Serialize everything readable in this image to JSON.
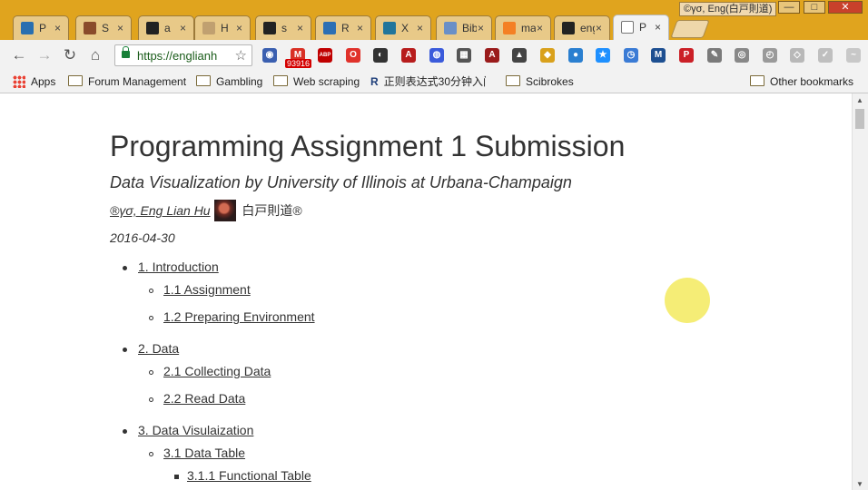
{
  "window": {
    "profile": "©γσ, Eng(白戸則道)",
    "minimize": "—",
    "maximize": "□",
    "close": "✕"
  },
  "tabs": [
    {
      "title": "P",
      "icon": "infinity-icon",
      "color": "#2a6fb0"
    },
    {
      "title": "S",
      "icon": "photo-icon",
      "color": "#8a4b2b"
    },
    {
      "title": "a",
      "icon": "github-icon",
      "color": "#222222"
    },
    {
      "title": "H",
      "icon": "chart-icon",
      "color": "#c0a070"
    },
    {
      "title": "s",
      "icon": "github-icon",
      "color": "#222222"
    },
    {
      "title": "R",
      "icon": "r-icon",
      "color": "#2c6fb4"
    },
    {
      "title": "X",
      "icon": "wordpress-icon",
      "color": "#21759b"
    },
    {
      "title": "Bibli",
      "icon": "r-icon",
      "color": "#6a8fc7"
    },
    {
      "title": "mar",
      "icon": "stackoverflow-icon",
      "color": "#f48024"
    },
    {
      "title": "engl",
      "icon": "github-icon",
      "color": "#222222"
    },
    {
      "title": "P",
      "icon": "page-icon",
      "color": "#ffffff"
    }
  ],
  "toolbar": {
    "back": "←",
    "forward": "→",
    "reload": "↻",
    "home": "⌂",
    "url": "https://englianh",
    "star": "☆"
  },
  "extensions": [
    {
      "icon": "globe-flag-icon",
      "color": "#3a5fb0",
      "glyph": "◉"
    },
    {
      "icon": "gmail-icon",
      "color": "#d93025",
      "glyph": "M",
      "badge": "93916"
    },
    {
      "icon": "adblock-icon",
      "color": "#c00000",
      "glyph": "ABP"
    },
    {
      "icon": "opera-icon",
      "color": "#e0322b",
      "glyph": "O"
    },
    {
      "icon": "owl-icon",
      "color": "#333333",
      "glyph": "◐"
    },
    {
      "icon": "pdf-icon",
      "color": "#b71c1c",
      "glyph": "A"
    },
    {
      "icon": "proxy-icon",
      "color": "#3b5bdb",
      "glyph": "◍"
    },
    {
      "icon": "photo-icon",
      "color": "#555555",
      "glyph": "▦"
    },
    {
      "icon": "pdf2-icon",
      "color": "#9a1b1b",
      "glyph": "A"
    },
    {
      "icon": "ublock-icon",
      "color": "#444444",
      "glyph": "▲"
    },
    {
      "icon": "shield-icon",
      "color": "#d9a11c",
      "glyph": "◆"
    },
    {
      "icon": "drop-icon",
      "color": "#2a7fd0",
      "glyph": "●"
    },
    {
      "icon": "star-ext-icon",
      "color": "#1e90ff",
      "glyph": "★"
    },
    {
      "icon": "clock-icon",
      "color": "#3a7bd5",
      "glyph": "◷"
    },
    {
      "icon": "m-icon",
      "color": "#1d4f91",
      "glyph": "M"
    },
    {
      "icon": "pinterest-icon",
      "color": "#cb2027",
      "glyph": "P"
    },
    {
      "icon": "tools-icon",
      "color": "#7a7a7a",
      "glyph": "✎"
    },
    {
      "icon": "camera-icon",
      "color": "#888888",
      "glyph": "◎"
    },
    {
      "icon": "timer-icon",
      "color": "#9a9a9a",
      "glyph": "◴"
    },
    {
      "icon": "shield2-icon",
      "color": "#b8b8b8",
      "glyph": "◇"
    },
    {
      "icon": "check-icon",
      "color": "#bfbfbf",
      "glyph": "✓"
    },
    {
      "icon": "fish-icon",
      "color": "#c8c8c8",
      "glyph": "~"
    }
  ],
  "bookmarks": {
    "apps": "Apps",
    "items": [
      "Forum Management",
      "Gambling",
      "Web scraping",
      "正则表达式30分钟入门",
      "Scibrokes"
    ],
    "other": "Other bookmarks"
  },
  "page": {
    "title": "Programming Assignment 1 Submission",
    "subtitle": "Data Visualization by University of Illinois at Urbana-Champaign",
    "author_link": "®γσ, Eng Lian Hu",
    "author_suffix": "白戸則道®",
    "date": "2016-04-30"
  },
  "toc": [
    {
      "level": 1,
      "text": "1. Introduction"
    },
    {
      "level": 2,
      "text": "1.1 Assignment"
    },
    {
      "level": 2,
      "text": "1.2 Preparing Environment"
    },
    {
      "level": 1,
      "text": "2. Data"
    },
    {
      "level": 2,
      "text": "2.1 Collecting Data"
    },
    {
      "level": 2,
      "text": "2.2 Read Data"
    },
    {
      "level": 1,
      "text": "3. Data Visulaization"
    },
    {
      "level": 2,
      "text": "3.1 Data Table"
    },
    {
      "level": 3,
      "text": "3.1.1 Functional Table"
    }
  ]
}
